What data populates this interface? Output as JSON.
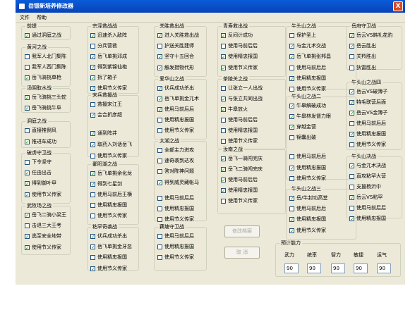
{
  "window": {
    "title": "岳银新培养修改器",
    "close": "X"
  },
  "menu": [
    "文件",
    "帮助"
  ],
  "groups": [
    {
      "title": "前提",
      "items": [
        {
          "label": "通过洞庭之战",
          "checked": true
        }
      ]
    },
    {
      "title": "黄河之战",
      "items": [
        {
          "label": "我军人北门集陈",
          "checked": false
        },
        {
          "label": "我军人西门集陈",
          "checked": false
        },
        {
          "label": "岳飞骑挑单枪",
          "checked": true
        }
      ]
    },
    {
      "title": "汤阴取水战",
      "items": [
        {
          "label": "岳飞骑挑三头蛇",
          "checked": true
        },
        {
          "label": "岳飞骑挑牛阜",
          "checked": true
        }
      ]
    },
    {
      "title": "洞庭之战",
      "items": [
        {
          "label": "直接推倒风",
          "checked": false
        },
        {
          "label": "推进车成功",
          "checked": true
        }
      ]
    },
    {
      "title": "破虏守卫战",
      "items": [
        {
          "label": "下令坚守",
          "checked": false
        },
        {
          "label": "任由出击",
          "checked": true
        },
        {
          "label": "得到御叶甲",
          "checked": true
        },
        {
          "label": "使用节义传家",
          "checked": true
        }
      ]
    },
    {
      "title": "武牧场之战",
      "items": [
        {
          "label": "岳飞二骑小梁王",
          "checked": true
        },
        {
          "label": "击退三大王考",
          "checked": false
        },
        {
          "label": "逃至安全地带",
          "checked": true
        },
        {
          "label": "使用节义传家",
          "checked": true
        }
      ]
    },
    {
      "title": "宗泽救战战",
      "items": [
        {
          "label": "迅速杀入敌阵",
          "checked": true
        },
        {
          "label": "分兵营救",
          "checked": false
        },
        {
          "label": "岳飞单挑邓成",
          "checked": true
        },
        {
          "label": "得到紫锦仙袍",
          "checked": true
        },
        {
          "label": "拆了箱子",
          "checked": true
        },
        {
          "label": "使用节义传家",
          "checked": true
        }
      ]
    },
    {
      "title": "宋兵救援战",
      "items": [
        {
          "label": "救援宋江王",
          "checked": false
        },
        {
          "label": "会合折彦超",
          "checked": true
        },
        {
          "label": "通到阵井",
          "checked": true
        },
        {
          "label": "取药入刘话岳飞",
          "checked": true
        },
        {
          "label": "使用节义传家",
          "checked": false
        }
      ]
    },
    {
      "title": "鄱阳湖之战",
      "items": [
        {
          "label": "岳飞单挑余化龙",
          "checked": true
        },
        {
          "label": "得到七星剑",
          "checked": true
        },
        {
          "label": "使用马前后王横",
          "checked": false
        },
        {
          "label": "使用精忠报国",
          "checked": false
        },
        {
          "label": "使用节义传家",
          "checked": false
        }
      ]
    },
    {
      "title": "粘罕奇袭战",
      "items": [
        {
          "label": "伏兵成功杀出",
          "checked": true
        },
        {
          "label": "岳飞单挑金牙忽",
          "checked": true
        },
        {
          "label": "使用精忠报国",
          "checked": false
        },
        {
          "label": "使用节义传家",
          "checked": true
        }
      ]
    },
    {
      "title": "关胜救出战",
      "items": [
        {
          "label": "进入关胜救出战",
          "checked": true
        },
        {
          "label": "护送关胜建师",
          "checked": false
        },
        {
          "label": "坚守十五回合",
          "checked": true
        },
        {
          "label": "触发措物代形",
          "checked": true
        }
      ]
    },
    {
      "title": "爱华山之战",
      "items": [
        {
          "label": "伏兵成功杀出",
          "checked": true
        },
        {
          "label": "岳飞单挑金兀术",
          "checked": true
        },
        {
          "label": "使用马前后后",
          "checked": true
        },
        {
          "label": "使用精忠报国",
          "checked": false
        },
        {
          "label": "使用节义传家",
          "checked": false
        }
      ]
    },
    {
      "title": "太湖之战",
      "items": [
        {
          "label": "全部主力进攻",
          "checked": false
        },
        {
          "label": "速奇袭到达攻",
          "checked": false
        },
        {
          "label": "答对陈神问题",
          "checked": false
        },
        {
          "label": "得到威灵藏帐马",
          "checked": true
        },
        {
          "label": "使用马前后后",
          "checked": false
        },
        {
          "label": "使用精忠报国",
          "checked": false
        },
        {
          "label": "使用节义传家",
          "checked": false
        }
      ]
    },
    {
      "title": "藕塘守卫战",
      "items": [
        {
          "label": "使用马前后后",
          "checked": false
        },
        {
          "label": "使用精忠报国",
          "checked": false
        },
        {
          "label": "使用节义传家",
          "checked": false
        }
      ]
    },
    {
      "title": "青寿救出战",
      "items": [
        {
          "label": "反间计成功",
          "checked": true
        },
        {
          "label": "使用马前后后",
          "checked": false
        },
        {
          "label": "使用精忠报国",
          "checked": true
        },
        {
          "label": "使用节义传家",
          "checked": true
        }
      ]
    },
    {
      "title": "茶陵关之战",
      "items": [
        {
          "label": "让张立一人出战",
          "checked": false
        },
        {
          "label": "与张立共同出战",
          "checked": true
        },
        {
          "label": "牛皋放火",
          "checked": true
        },
        {
          "label": "使用马前后后",
          "checked": false
        },
        {
          "label": "使用精忠报国",
          "checked": false
        },
        {
          "label": "使用节义传家",
          "checked": false
        }
      ]
    },
    {
      "title": "汝南之战",
      "items": [
        {
          "label": "岳飞一骑闯完庆",
          "checked": true
        },
        {
          "label": "岳飞二骑闯完庆",
          "checked": true
        },
        {
          "label": "使用马前后后",
          "checked": true
        },
        {
          "label": "使用精忠报国",
          "checked": true
        },
        {
          "label": "使用节义传家",
          "checked": false
        }
      ]
    },
    {
      "title": "牛头山之战",
      "items": [
        {
          "label": "保护圣上",
          "checked": false
        },
        {
          "label": "与金兀术交战",
          "checked": true
        },
        {
          "label": "岳飞单挑张邦昌",
          "checked": true
        },
        {
          "label": "使用马前后后",
          "checked": false
        },
        {
          "label": "使用精忠报国",
          "checked": true
        },
        {
          "label": "使用节义传家",
          "checked": false
        }
      ]
    },
    {
      "title": "牛头山之战二",
      "items": [
        {
          "label": "牛皋解破成功",
          "checked": true
        },
        {
          "label": "牛皋林发督力眼",
          "checked": true
        },
        {
          "label": "穿越金营",
          "checked": true
        },
        {
          "label": "锦囊出破",
          "checked": false
        },
        {
          "label": "使用马前后后",
          "checked": false
        },
        {
          "label": "使用精忠报国",
          "checked": true
        },
        {
          "label": "使用节义传家",
          "checked": false
        }
      ]
    },
    {
      "title": "牛头山之战三",
      "items": [
        {
          "label": "岳/牛封功高堂",
          "checked": true
        },
        {
          "label": "使用马前后后",
          "checked": false
        },
        {
          "label": "使用精忠报国",
          "checked": true
        },
        {
          "label": "使用节义传家",
          "checked": true
        }
      ]
    },
    {
      "title": "岳府守卫战",
      "items": [
        {
          "label": "岳云VS韩礼花豹",
          "checked": true
        },
        {
          "label": "岳云胜出",
          "checked": true
        },
        {
          "label": "关羚胜出",
          "checked": false
        },
        {
          "label": "狄雷胜出",
          "checked": false
        }
      ]
    },
    {
      "title": "牛头山之战四",
      "items": [
        {
          "label": "岳云VS破簿子",
          "checked": true
        },
        {
          "label": "特毛联营后面",
          "checked": true
        },
        {
          "label": "岳云VS金簿子",
          "checked": true
        },
        {
          "label": "使用马前后后",
          "checked": false
        },
        {
          "label": "使用精忠报国",
          "checked": true
        },
        {
          "label": "使用节义传家",
          "checked": false
        }
      ]
    },
    {
      "title": "牛头山决战",
      "items": [
        {
          "label": "与金兀术决战",
          "checked": true
        },
        {
          "label": "直攻粘罕大营",
          "checked": false
        },
        {
          "label": "支援杨沂中",
          "checked": false
        },
        {
          "label": "岳云VS粘罕",
          "checked": true
        },
        {
          "label": "使用马前后后",
          "checked": false
        },
        {
          "label": "使用精忠报国",
          "checked": true
        }
      ]
    }
  ],
  "buttons": {
    "modify": "修改档案",
    "cancel": "取 消"
  },
  "ability": {
    "title": "预计能力",
    "labels": [
      "武力",
      "统率",
      "智力",
      "敏捷",
      "运气"
    ],
    "values": [
      "90",
      "90",
      "90",
      "90",
      "90"
    ]
  }
}
